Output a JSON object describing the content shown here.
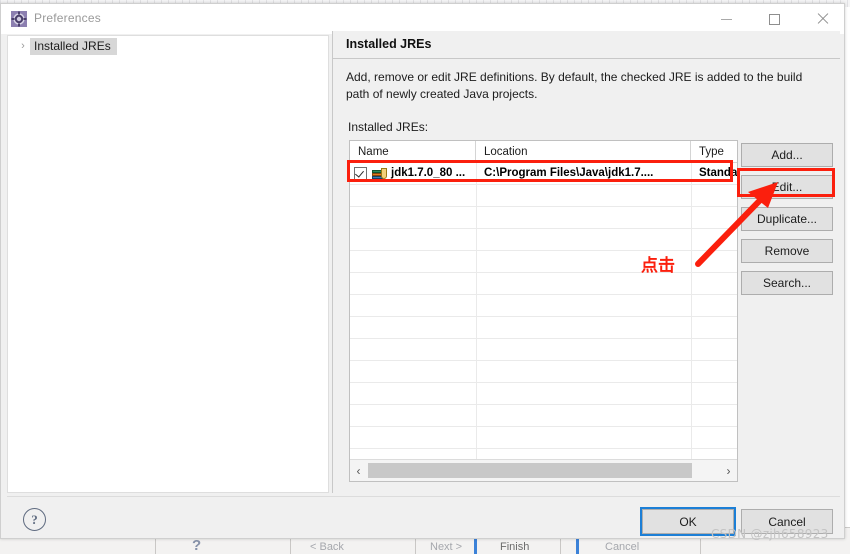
{
  "window": {
    "title": "Preferences",
    "icon": "preferences-gear-icon",
    "controls": {
      "minimize": "minimize-icon",
      "maximize": "maximize-icon",
      "close": "close-icon"
    }
  },
  "sidebar": {
    "items": [
      {
        "label": "Installed JREs",
        "expander": "›",
        "selected": true
      }
    ]
  },
  "page": {
    "title": "Installed JREs",
    "description": "Add, remove or edit JRE definitions. By default, the checked JRE is added to the build path of newly created Java projects.",
    "list_label": "Installed JREs:"
  },
  "table": {
    "columns": [
      "Name",
      "Location",
      "Type"
    ],
    "rows": [
      {
        "checked": true,
        "icon": "jre-library-icon",
        "name": "jdk1.7.0_80 ...",
        "location": "C:\\Program Files\\Java\\jdk1.7....",
        "type": "Standa"
      }
    ],
    "scrollbar": {
      "left_arrow": "‹",
      "right_arrow": "›"
    }
  },
  "side_buttons": [
    {
      "label": "Add...",
      "name": "add-button"
    },
    {
      "label": "Edit...",
      "name": "edit-button"
    },
    {
      "label": "Duplicate...",
      "name": "duplicate-button"
    },
    {
      "label": "Remove",
      "name": "remove-button"
    },
    {
      "label": "Search...",
      "name": "search-button"
    }
  ],
  "footer": {
    "help": "?",
    "ok": "OK",
    "cancel": "Cancel"
  },
  "annotations": {
    "click_text": "点击",
    "highlight_color": "#fb1f0d",
    "focus_color": "#1c7fd6"
  },
  "watermark": "CSDN @zjh658923",
  "background_wizard": {
    "buttons": [
      "< Back",
      "Next >",
      "Finish",
      "Cancel"
    ],
    "help": "?"
  }
}
